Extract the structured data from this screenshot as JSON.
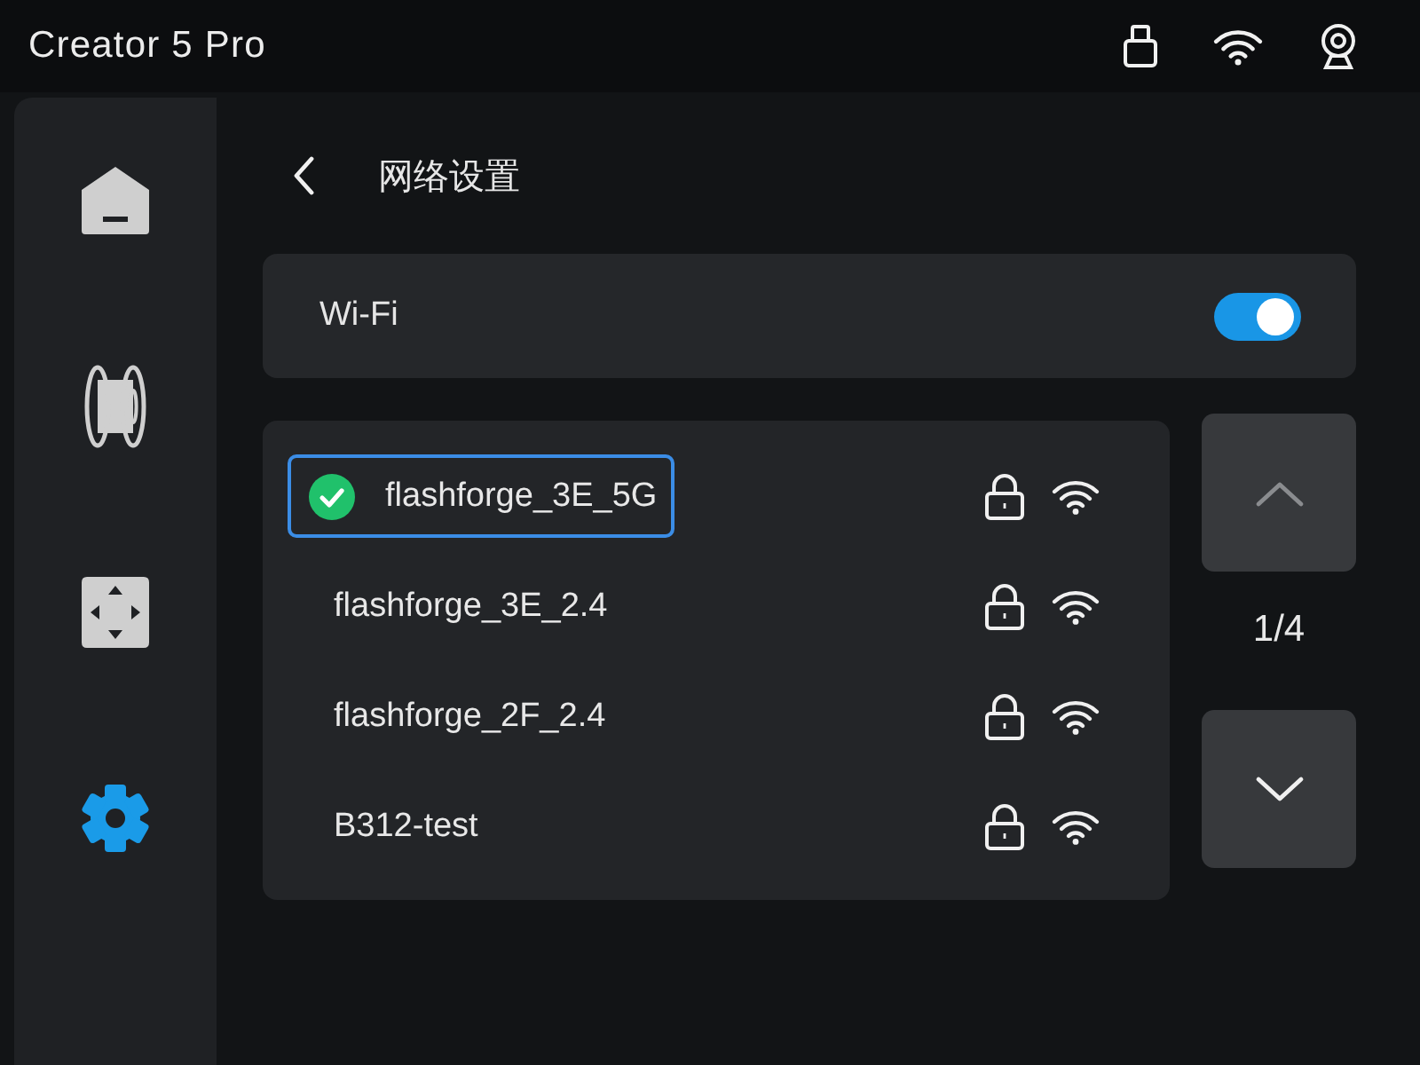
{
  "header": {
    "title": "Creator 5 Pro"
  },
  "sidebar": {
    "items": [
      {
        "kind": "home",
        "selected": false
      },
      {
        "kind": "filament",
        "selected": false
      },
      {
        "kind": "move",
        "selected": false
      },
      {
        "kind": "settings",
        "selected": true
      }
    ]
  },
  "page": {
    "title": "网络设置"
  },
  "wifi": {
    "label": "Wi-Fi",
    "on": true
  },
  "networks": [
    {
      "name": "flashforge_3E_5G",
      "selected": true,
      "connected": true,
      "secured": true
    },
    {
      "name": "flashforge_3E_2.4",
      "selected": false,
      "connected": false,
      "secured": true
    },
    {
      "name": "flashforge_2F_2.4",
      "selected": false,
      "connected": false,
      "secured": true
    },
    {
      "name": "B312-test",
      "selected": false,
      "connected": false,
      "secured": true
    }
  ],
  "pager": {
    "up": {
      "disabled": true
    },
    "page": "1/4",
    "down": {
      "disabled": false
    }
  }
}
